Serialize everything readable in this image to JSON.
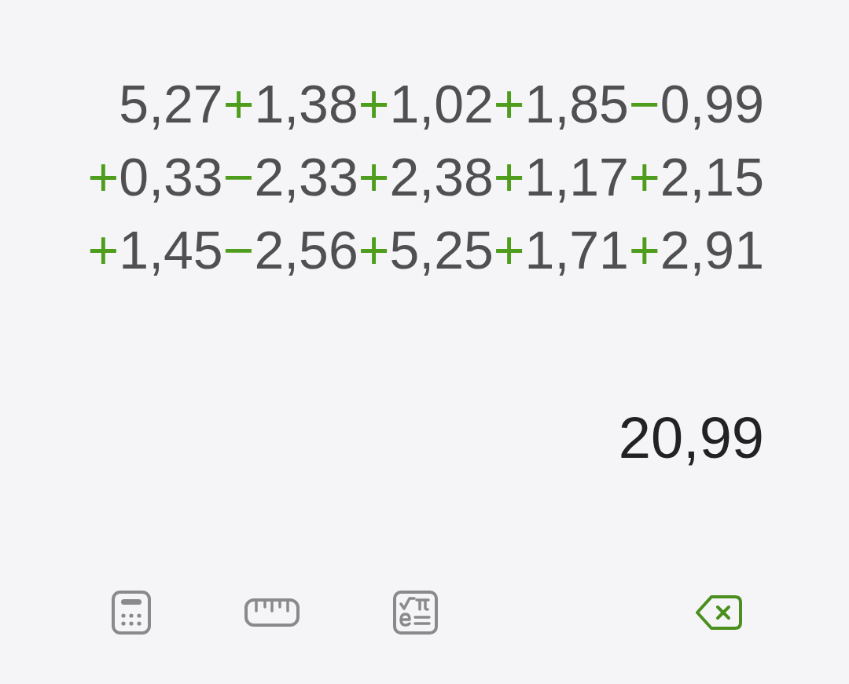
{
  "expression": {
    "lines": [
      {
        "tokens": [
          {
            "kind": "number",
            "text": "5,27"
          },
          {
            "kind": "operator",
            "text": "+"
          },
          {
            "kind": "number",
            "text": "1,38"
          },
          {
            "kind": "operator",
            "text": "+"
          },
          {
            "kind": "number",
            "text": "1,02"
          },
          {
            "kind": "operator",
            "text": "+"
          },
          {
            "kind": "number",
            "text": "1,85"
          },
          {
            "kind": "operator",
            "text": "−"
          },
          {
            "kind": "number",
            "text": "0,99"
          }
        ]
      },
      {
        "tokens": [
          {
            "kind": "operator",
            "text": "+"
          },
          {
            "kind": "number",
            "text": "0,33"
          },
          {
            "kind": "operator",
            "text": "−"
          },
          {
            "kind": "number",
            "text": "2,33"
          },
          {
            "kind": "operator",
            "text": "+"
          },
          {
            "kind": "number",
            "text": "2,38"
          },
          {
            "kind": "operator",
            "text": "+"
          },
          {
            "kind": "number",
            "text": "1,17"
          },
          {
            "kind": "operator",
            "text": "+"
          },
          {
            "kind": "number",
            "text": "2,15"
          }
        ]
      },
      {
        "tokens": [
          {
            "kind": "operator",
            "text": "+"
          },
          {
            "kind": "number",
            "text": "1,45"
          },
          {
            "kind": "operator",
            "text": "−"
          },
          {
            "kind": "number",
            "text": "2,56"
          },
          {
            "kind": "operator",
            "text": "+"
          },
          {
            "kind": "number",
            "text": "5,25"
          },
          {
            "kind": "operator",
            "text": "+"
          },
          {
            "kind": "number",
            "text": "1,71"
          },
          {
            "kind": "operator",
            "text": "+"
          },
          {
            "kind": "number",
            "text": "2,91"
          }
        ]
      }
    ]
  },
  "result": "20,99",
  "toolbar": {
    "backspace": {
      "disabled": false
    }
  }
}
